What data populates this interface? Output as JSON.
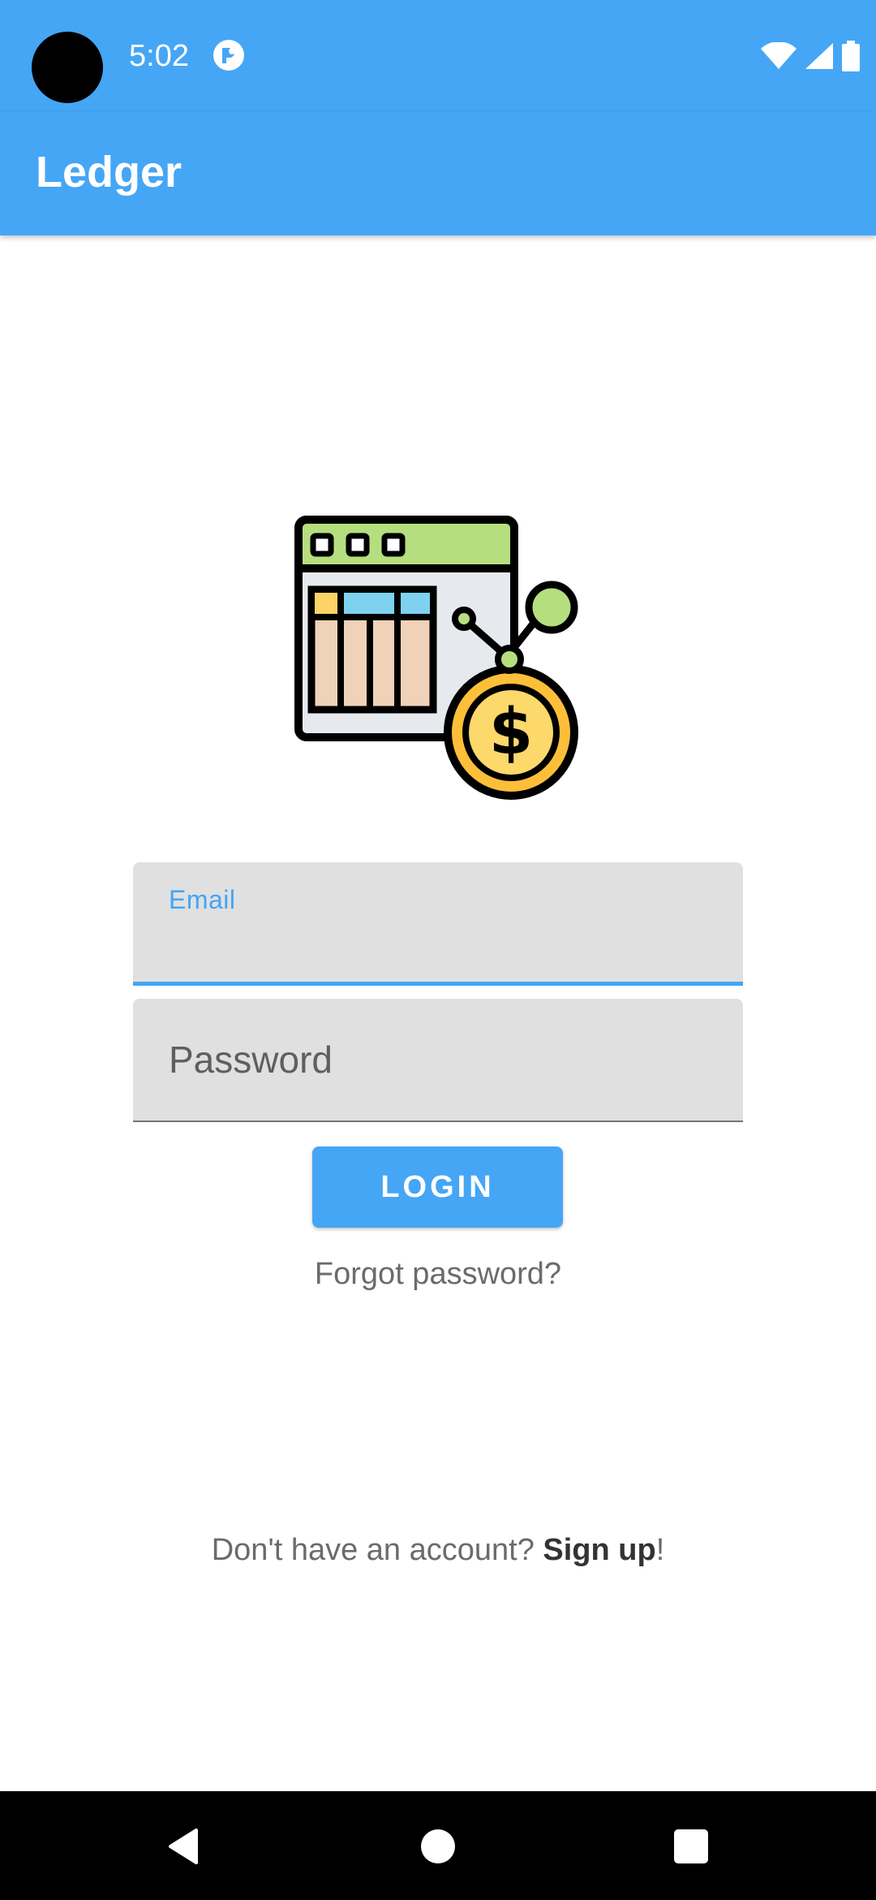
{
  "status_bar": {
    "time": "5:02"
  },
  "app_bar": {
    "title": "Ledger"
  },
  "login_form": {
    "email_label": "Email",
    "password_placeholder": "Password",
    "login_button": "LOGIN",
    "forgot_password": "Forgot password?",
    "signup_prompt": "Don't have an account? ",
    "signup_link": "Sign up",
    "signup_suffix": "!"
  },
  "icons": {
    "status_app": "app-notification-icon",
    "wifi": "wifi-icon",
    "signal": "cell-signal-icon",
    "battery": "battery-icon",
    "logo": "ledger-spreadsheet-dollar-icon",
    "nav_back": "back-icon",
    "nav_home": "home-icon",
    "nav_recents": "recents-icon"
  },
  "colors": {
    "primary": "#45a6f5",
    "field_background": "#e0e0e0",
    "accent_focus": "#42a5f5"
  }
}
